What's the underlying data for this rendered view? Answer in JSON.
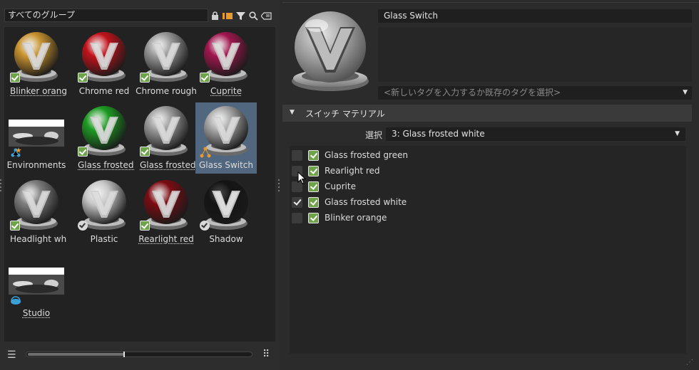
{
  "group_selector": {
    "label": "すべてのグループ"
  },
  "toolbar_icons": [
    "lock-icon",
    "add-tag-icon",
    "filter-icon",
    "search-icon",
    "clear-search-icon"
  ],
  "materials": [
    {
      "label": "Blinker orange",
      "color": "#c8922e",
      "badge": "check",
      "underline": true
    },
    {
      "label": "Chrome red",
      "color": "#c0121a",
      "badge": "check",
      "underline": false
    },
    {
      "label": "Chrome rough",
      "color": "#9a9a9a",
      "badge": "check",
      "underline": false
    },
    {
      "label": "Cuprite",
      "color": "#a0164e",
      "badge": "check",
      "underline": true
    },
    {
      "label": "Environments",
      "color": "#ffffff",
      "badge": "env",
      "underline": false
    },
    {
      "label": "Glass frosted gr",
      "color": "#1c9a22",
      "badge": "check",
      "underline": true
    },
    {
      "label": "Glass frosted w",
      "color": "#9c9c9c",
      "badge": "check",
      "underline": true
    },
    {
      "label": "Glass Switch",
      "color": "#a8a8a8",
      "badge": "switch",
      "underline": false
    },
    {
      "label": "Headlight whit",
      "color": "#7e7e7e",
      "badge": "check",
      "underline": false
    },
    {
      "label": "Plastic",
      "color": "#c8c8c8",
      "badge": "circle",
      "underline": false
    },
    {
      "label": "Rearlight red",
      "color": "#7a0c12",
      "badge": "check",
      "underline": true
    },
    {
      "label": "Shadow",
      "color": "#141414",
      "badge": "circle",
      "underline": false
    },
    {
      "label": "Studio",
      "color": "#ffffff",
      "badge": "studio",
      "underline": true
    }
  ],
  "detail": {
    "name": "Glass Switch",
    "tag_placeholder": "<新しいタグを入力するか既存のタグを選択>",
    "section_title": "スイッチ マテリアル",
    "select_label": "選択",
    "select_value": "3: Glass frosted white",
    "switch_items": [
      {
        "label": "Glass frosted green",
        "checked": false
      },
      {
        "label": "Rearlight red",
        "checked": false
      },
      {
        "label": "Cuprite",
        "checked": false
      },
      {
        "label": "Glass frosted white",
        "checked": true
      },
      {
        "label": "Blinker orange",
        "checked": false
      }
    ]
  },
  "colors": {
    "accent_selected": "#51677f",
    "badge_green": "#6fa34a"
  }
}
